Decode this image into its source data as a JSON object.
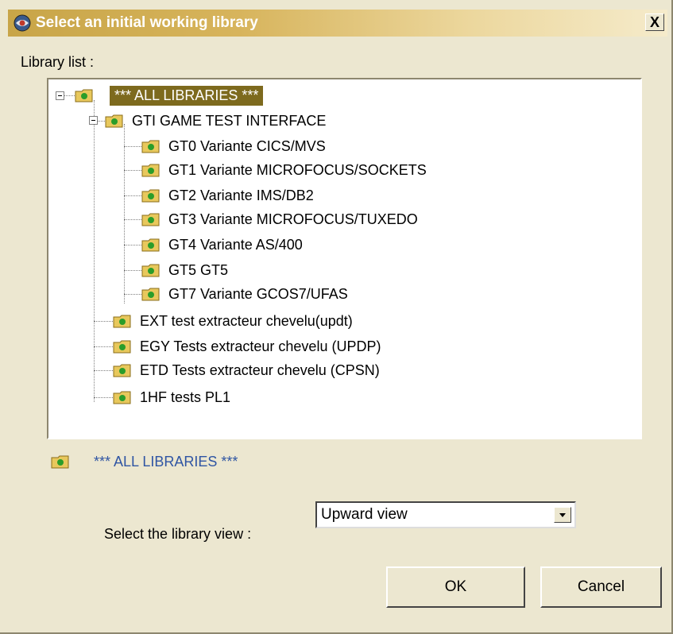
{
  "dialog": {
    "title": "Select an initial working library",
    "close_label": "X"
  },
  "library_list": {
    "label": "Library list :",
    "nodes": [
      {
        "label": "*** ALL LIBRARIES ***",
        "level": 0,
        "expanded": true,
        "selected": true
      },
      {
        "label": "GTI GAME TEST INTERFACE",
        "level": 1,
        "expanded": true,
        "selected": false
      },
      {
        "label": "GT0 Variante CICS/MVS",
        "level": 2,
        "selected": false
      },
      {
        "label": "GT1 Variante MICROFOCUS/SOCKETS",
        "level": 2,
        "selected": false
      },
      {
        "label": "GT2 Variante IMS/DB2",
        "level": 2,
        "selected": false
      },
      {
        "label": "GT3 Variante MICROFOCUS/TUXEDO",
        "level": 2,
        "selected": false
      },
      {
        "label": "GT4 Variante AS/400",
        "level": 2,
        "selected": false
      },
      {
        "label": "GT5 GT5",
        "level": 2,
        "selected": false
      },
      {
        "label": "GT7 Variante GCOS7/UFAS",
        "level": 2,
        "selected": false
      },
      {
        "label": "EXT test extracteur chevelu(updt)",
        "level": 1,
        "selected": false
      },
      {
        "label": "EGY Tests extracteur chevelu (UPDP)",
        "level": 1,
        "selected": false
      },
      {
        "label": "ETD Tests extracteur chevelu (CPSN)",
        "level": 1,
        "selected": false
      },
      {
        "label": "1HF tests PL1",
        "level": 1,
        "selected": false
      }
    ]
  },
  "selected_library": {
    "label": "*** ALL LIBRARIES ***"
  },
  "library_view": {
    "label": "Select the library view :",
    "value": "Upward view"
  },
  "buttons": {
    "ok": "OK",
    "cancel": "Cancel"
  },
  "colors": {
    "title_gradient_start": "#c8a548",
    "selection": "#7d6a1e",
    "selected_text": "#2f55a3",
    "folder": "#e8c85c",
    "folder_dot": "#2a9d2a"
  }
}
